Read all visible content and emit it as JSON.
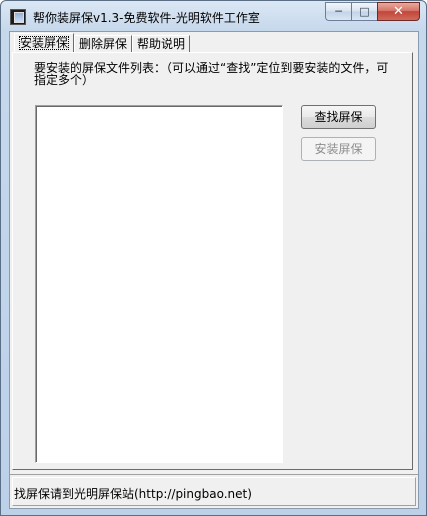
{
  "window": {
    "title": "帮你装屏保v1.3-免费软件-光明软件工作室",
    "caption": {
      "minimize": "─",
      "maximize": "□",
      "close": "✕"
    }
  },
  "tabs": [
    {
      "label": "安装屏保",
      "active": true
    },
    {
      "label": "删除屏保",
      "active": false
    },
    {
      "label": "帮助说明",
      "active": false
    }
  ],
  "install_panel": {
    "instruction": "要安装的屏保文件列表：（可以通过“查找”定位到要安装的文件，可指定多个）",
    "find_button": "查找屏保",
    "install_button": "安装屏保"
  },
  "status": {
    "text": "找屏保请到光明屏保站(http://pingbao.net)"
  },
  "colors": {
    "frame": "#c6d8ec",
    "client": "#f0f0f0",
    "close_button": "#c0453a"
  },
  "icons": {
    "app": "screensaver-app-icon"
  }
}
